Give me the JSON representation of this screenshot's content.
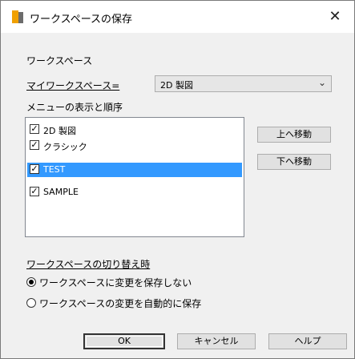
{
  "window": {
    "title": "ワークスペースの保存",
    "close": "✕"
  },
  "workspace_group": {
    "title": "ワークスペース",
    "my_workspace_label": "マイワークスペース=",
    "combo_value": "2D 製図",
    "combo_arrow": "⌄"
  },
  "menu_group": {
    "title": "メニューの表示と順序",
    "items": [
      {
        "label": "2D 製図",
        "checked": true,
        "selected": false
      },
      {
        "label": "クラシック",
        "checked": true,
        "selected": false
      },
      {
        "label": "TEST",
        "checked": true,
        "selected": true
      },
      {
        "label": "SAMPLE",
        "checked": true,
        "selected": false
      }
    ],
    "move_up": "上へ移動",
    "move_down": "下へ移動"
  },
  "switch_group": {
    "title": "ワークスペースの切り替え時",
    "option1": "ワークスペースに変更を保存しない",
    "option2": "ワークスペースの変更を自動的に保存",
    "selected": 1
  },
  "buttons": {
    "ok": "OK",
    "cancel": "キャンセル",
    "help": "ヘルプ"
  }
}
